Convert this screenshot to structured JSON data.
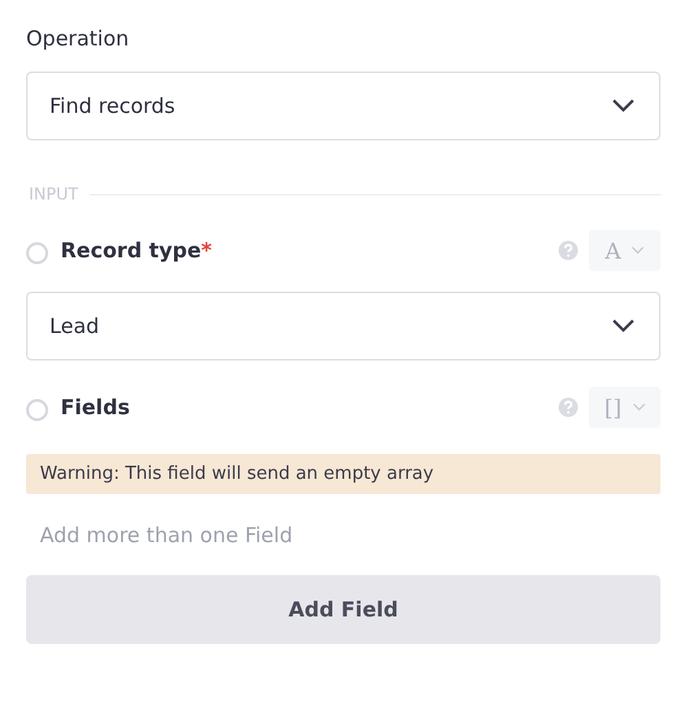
{
  "operation": {
    "label": "Operation",
    "value": "Find records"
  },
  "section": {
    "title": "INPUT"
  },
  "inputs": [
    {
      "kind": "select",
      "label": "Record type",
      "required_mark": "*",
      "checked": false,
      "type_symbol": "A",
      "value": "Lead"
    },
    {
      "kind": "array",
      "label": "Fields",
      "checked": false,
      "type_symbol": "[]",
      "warning": "Warning: This field will send an empty array",
      "empty_hint": "Add more than one Field",
      "add_button": "Add Field"
    }
  ]
}
